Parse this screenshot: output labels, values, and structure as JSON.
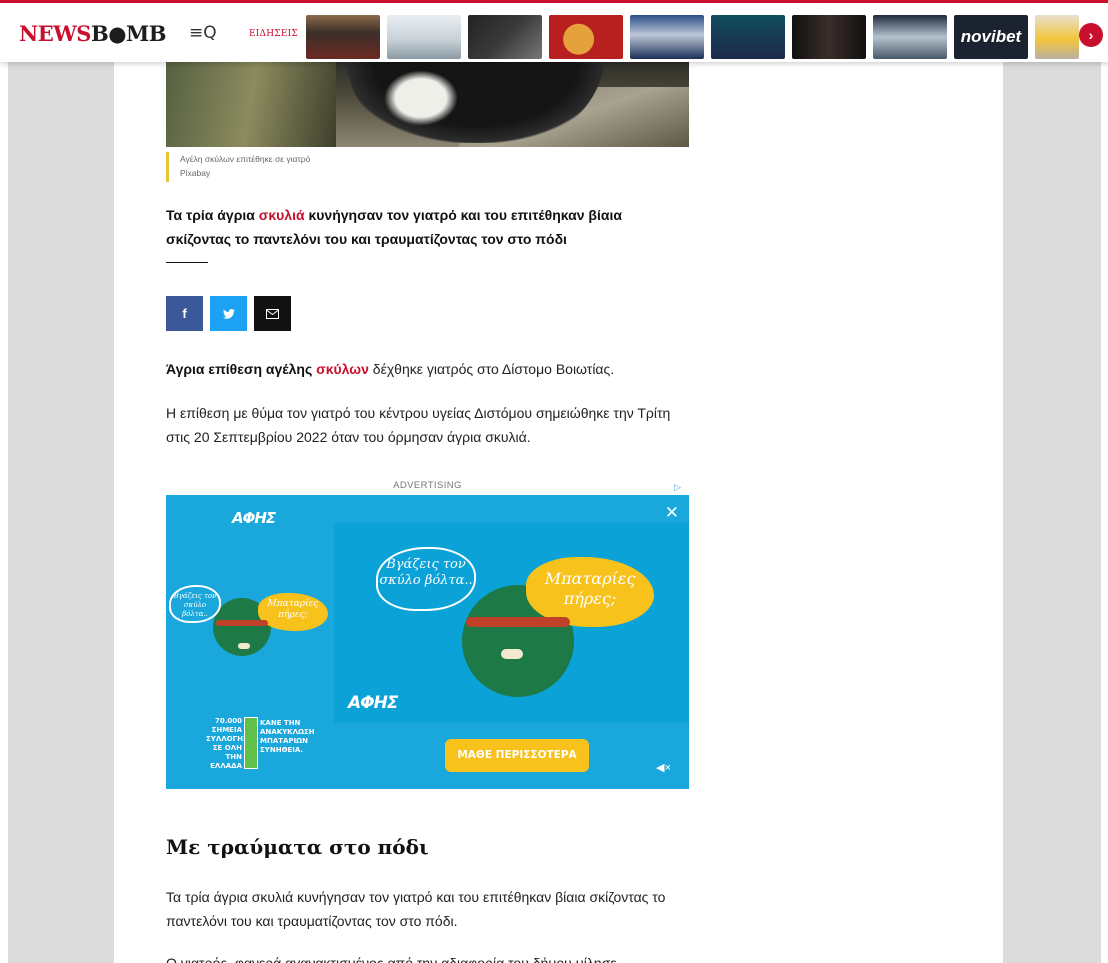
{
  "header": {
    "logo_part1": "NEWS",
    "logo_part2": "B",
    "logo_part3": "MB",
    "logo_bomb_glyph": "●",
    "menu_glyph": "≡Q",
    "news_label": "ΕΙΔΗΣΕΙΣ",
    "sponsor_thumb_text": "novibet",
    "next_arrow": "›"
  },
  "article": {
    "image_caption": "Αγέλη σκύλων επιτέθηκε σε γιατρό",
    "image_credit": "Pixabay",
    "lead": {
      "before": "Τα τρία άγρια ",
      "link": "σκυλιά",
      "after": " κυνήγησαν τον γιατρό και του επιτέθηκαν βίαια σκίζοντας το παντελόνι του και τραυματίζοντας τον στο πόδι"
    },
    "share": {
      "facebook": "f",
      "twitter": "t",
      "email": "✉"
    },
    "para1": {
      "bold_before": "Άγρια επίθεση αγέλης ",
      "link": "σκύλων",
      "after": " δέχθηκε γιατρός στο Δίστομο Βοιωτίας."
    },
    "para2": "Η επίθεση με θύμα τον γιατρό του κέντρου υγείας Διστόμου σημειώθηκε την Τρίτη στις 20 Σεπτεμβρίου 2022 όταν του όρμησαν άγρια σκυλιά.",
    "subheading": "Με τραύματα στο πόδι",
    "para3": "Τα τρία άγρια σκυλιά κυνήγησαν τον γιατρό και του επιτέθηκαν βίαια σκίζοντας το παντελόνι του και τραυματίζοντας τον στο πόδι.",
    "para4_partial": "Ο γιατρός, φανερά αγανακτισμένος από την αδιαφορία του δήμου μίλησε"
  },
  "advertising": {
    "label": "ADVERTISING",
    "choices_icon": "▷",
    "brand": "AΦΗΣ",
    "close": "✕",
    "bubble_white": "Βγάζεις τον σκύλο βόλτα..",
    "bubble_yellow": "Μπαταρίες πήρες;",
    "stat_left": "70.000 ΣΗΜΕΙΑ ΣΥΛΛΟΓΗΣ ΣΕ ΟΛΗ ΤΗΝ ΕΛΛΑΔΑ",
    "stat_right": "ΚΑΝΕ ΤΗΝ ΑΝΑΚΥΚΛΩΣΗ ΜΠΑΤΑΡΙΩΝ ΣΥΝΗΘΕΙΑ.",
    "cta": "ΜΑΘΕ ΠΕΡΙΣΣΟΤΕΡΑ",
    "mute": "◀×"
  }
}
